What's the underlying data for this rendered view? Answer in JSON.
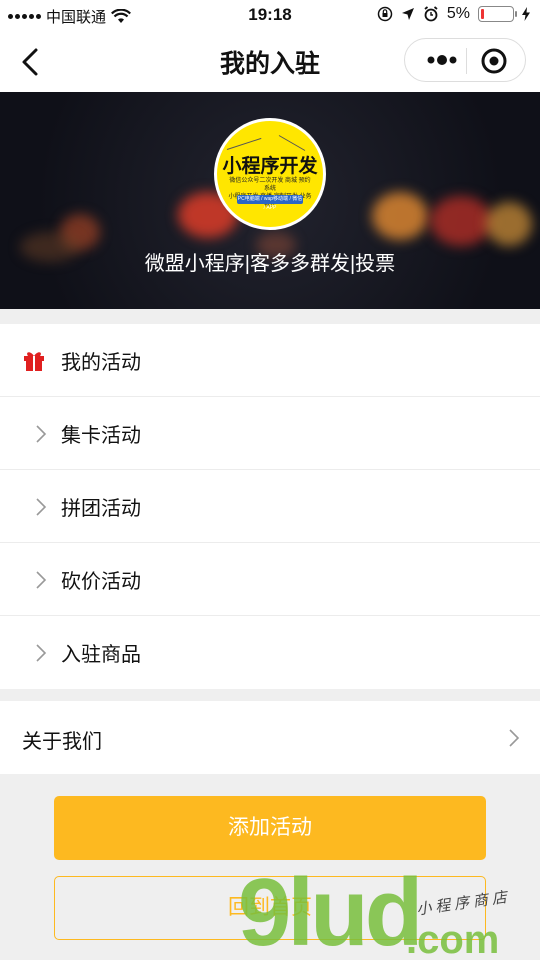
{
  "status_bar": {
    "carrier": "中国联通",
    "time": "19:18",
    "battery": "5%",
    "icons": [
      "signal-icon",
      "wifi-icon",
      "orientation-lock-icon",
      "location-icon",
      "alarm-icon",
      "battery-icon",
      "charging-icon"
    ]
  },
  "nav": {
    "title": "我的入驻",
    "back_icon": "chevron-left-icon",
    "more_icon": "more-dots-icon",
    "close_icon": "target-circle-icon"
  },
  "banner": {
    "logo_title": "小程序开发",
    "logo_line1": "微信公众号二次开发 商城 预约系统",
    "logo_line2": "小程序开发 直播 定制开发 业务软件",
    "logo_band": "PC电脑端 / wap移动端 / 微信 / APP",
    "caption": "微盟小程序|客多多群发|投票"
  },
  "menu": {
    "header": {
      "label": "我的活动",
      "icon": "gift-icon",
      "icon_color": "#e02020"
    },
    "items": [
      {
        "label": "集卡活动"
      },
      {
        "label": "拼团活动"
      },
      {
        "label": "砍价活动"
      },
      {
        "label": "入驻商品"
      }
    ]
  },
  "about": {
    "label": "关于我们"
  },
  "buttons": {
    "add_activity": "添加活动",
    "back_home": "回到首页"
  },
  "watermark": {
    "brand": "9lud",
    "domain": ".com",
    "text": "小程序商店"
  },
  "colors": {
    "accent": "#fdb920",
    "gift": "#e02020",
    "battery_low": "#e33333"
  }
}
